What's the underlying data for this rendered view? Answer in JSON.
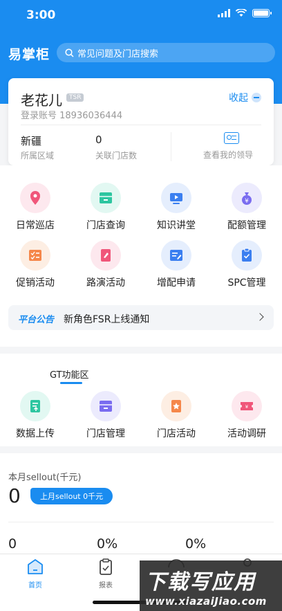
{
  "status_bar": {
    "time": "3:00"
  },
  "header": {
    "title": "易掌柜",
    "search_placeholder": "常见问题及门店搜索"
  },
  "profile": {
    "name": "老花儿",
    "badge": "TSR",
    "collapse_label": "收起",
    "account_label": "登录账号 18936036444",
    "region_value": "新疆",
    "region_label": "所属区域",
    "stores_value": "0",
    "stores_label": "关联门店数",
    "leader_label": "查看我的领导"
  },
  "grid": [
    {
      "label": "日常巡店",
      "icon": "location-pin-icon",
      "color": "#f0567a",
      "bg": "#fde8ee"
    },
    {
      "label": "门店查询",
      "icon": "store-icon",
      "color": "#2dc6a0",
      "bg": "#e2f8f2"
    },
    {
      "label": "知识讲堂",
      "icon": "video-icon",
      "color": "#3b7ff0",
      "bg": "#e5eefd"
    },
    {
      "label": "配额管理",
      "icon": "money-bag-icon",
      "color": "#7a6cf0",
      "bg": "#ecebfd"
    },
    {
      "label": "促销活动",
      "icon": "checklist-icon",
      "color": "#f5874a",
      "bg": "#fdeee3"
    },
    {
      "label": "路演活动",
      "icon": "edit-note-icon",
      "color": "#f0567a",
      "bg": "#fde8ee"
    },
    {
      "label": "增配申请",
      "icon": "form-edit-icon",
      "color": "#3b7ff0",
      "bg": "#e5eefd"
    },
    {
      "label": "SPC管理",
      "icon": "clipboard-check-icon",
      "color": "#3b7ff0",
      "bg": "#e5eefd"
    }
  ],
  "notice": {
    "tag": "平台公告",
    "text": "新角色FSR上线通知"
  },
  "gt": {
    "title": "GT功能区",
    "items": [
      {
        "label": "数据上传",
        "icon": "upload-doc-icon",
        "color": "#2dc6a0",
        "bg": "#e2f8f2"
      },
      {
        "label": "门店管理",
        "icon": "store-icon",
        "color": "#7a6cf0",
        "bg": "#ecebfd"
      },
      {
        "label": "门店活动",
        "icon": "star-badge-icon",
        "color": "#f5874a",
        "bg": "#fdeee3"
      },
      {
        "label": "活动调研",
        "icon": "ticket-icon",
        "color": "#f0567a",
        "bg": "#fde8ee"
      }
    ]
  },
  "sellout": {
    "label": "本月sellout(千元)",
    "value": "0",
    "last_month": "上月sellout 0千元",
    "metrics": [
      "0",
      "0%",
      "0%"
    ]
  },
  "tabs": [
    {
      "label": "首页",
      "icon": "home-icon",
      "active": true
    },
    {
      "label": "报表",
      "icon": "report-icon",
      "active": false
    }
  ],
  "watermark": {
    "big": "下载写应用",
    "small": "www.xiazaiJiao.com"
  }
}
